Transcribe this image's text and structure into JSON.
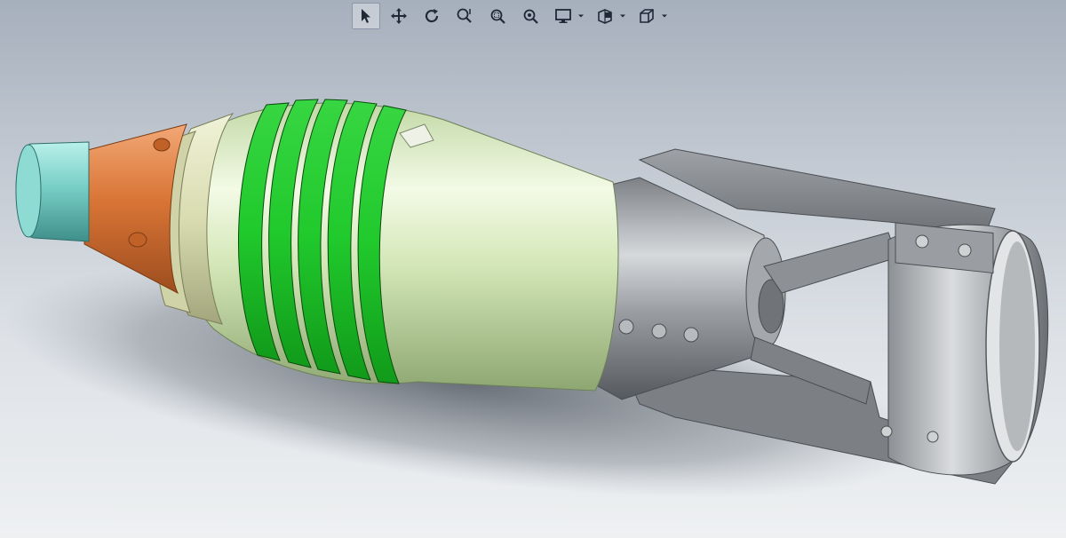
{
  "toolbar": {
    "buttons": [
      {
        "name": "select-tool-button",
        "icon": "cursor-arrow-icon",
        "active": true
      },
      {
        "name": "pan-tool-button",
        "icon": "pan-move-icon",
        "active": false
      },
      {
        "name": "rotate-tool-button",
        "icon": "rotate-icon",
        "active": false
      },
      {
        "name": "zoom-in-out-button",
        "icon": "zoom-in-out-icon",
        "active": false
      },
      {
        "name": "zoom-to-area-button",
        "icon": "zoom-area-icon",
        "active": false
      },
      {
        "name": "zoom-to-fit-button",
        "icon": "zoom-fit-icon",
        "active": false
      },
      {
        "name": "display-style-button",
        "icon": "monitor-icon",
        "has_dropdown": true
      },
      {
        "name": "view-settings-button",
        "icon": "view-settings-icon",
        "has_dropdown": true
      },
      {
        "name": "view-orientation-button",
        "icon": "cube-icon",
        "has_dropdown": true
      }
    ],
    "icon_color": "#1f2937"
  },
  "model": {
    "description_hidden": true,
    "colors": {
      "fuze_tip": "#7fd4cc",
      "fuze_body": "#e07a3c",
      "shell_body": "#d8ecc0",
      "driving_bands": "#1ec62a",
      "tail_metal": "#8a8e92"
    }
  }
}
